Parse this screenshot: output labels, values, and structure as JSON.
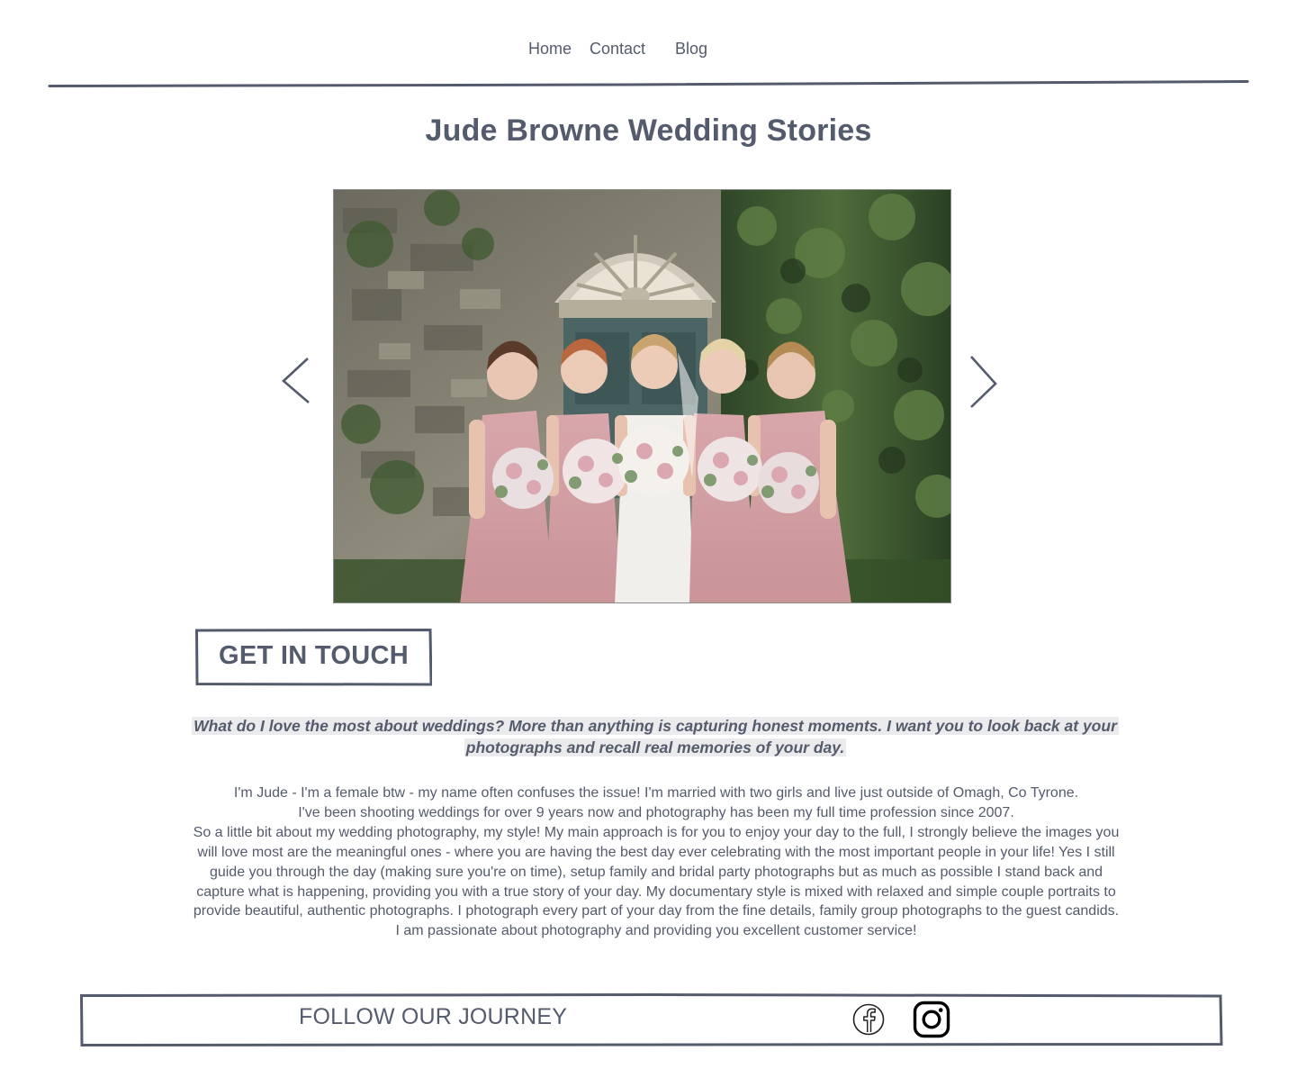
{
  "nav": {
    "items": [
      {
        "label": "Home"
      },
      {
        "label": "Contact"
      },
      {
        "label": "Blog"
      }
    ]
  },
  "page": {
    "title": "Jude Browne Wedding Stories"
  },
  "carousel": {
    "prev_icon": "chevron-left-icon",
    "next_icon": "chevron-right-icon"
  },
  "cta": {
    "label": "GET IN TOUCH"
  },
  "quote": {
    "text": "What do I love the most about weddings? More than anything is capturing honest moments. I want you to look back at your photographs and recall real memories of your day."
  },
  "bio": {
    "paragraphs": [
      "I'm Jude - I'm a female btw - my name often confuses the issue! I'm married with two girls and live just outside of Omagh, Co Tyrone.",
      "I've been shooting weddings for over 9 years now and photography has been my full time profession since 2007.",
      "So a little bit about my wedding photography, my style! My main approach is for you to enjoy your day to the full, I strongly believe the images you will love most are the meaningful ones - where you are having the best day ever celebrating with the most important people in your life! Yes I still guide you through the day (making sure you're on time), setup family and bridal party photographs but as much as possible I stand back and capture what is happening, providing you with a true story of your day. My documentary style is mixed with relaxed and simple couple portraits to provide beautiful, authentic photographs. I photograph every part of your day from the fine details, family group photographs to the guest candids. I am passionate about photography and providing you excellent customer service!"
    ]
  },
  "footer": {
    "label": "FOLLOW OUR JOURNEY",
    "social": [
      {
        "icon": "facebook-icon"
      },
      {
        "icon": "instagram-icon"
      }
    ]
  },
  "colors": {
    "text": "#545b6c",
    "highlight": "#ebebed",
    "dress_pink": "#d9a9ad",
    "foliage": "#3f5a32",
    "stone": "#8d8a7c",
    "door": "#4b6464"
  }
}
